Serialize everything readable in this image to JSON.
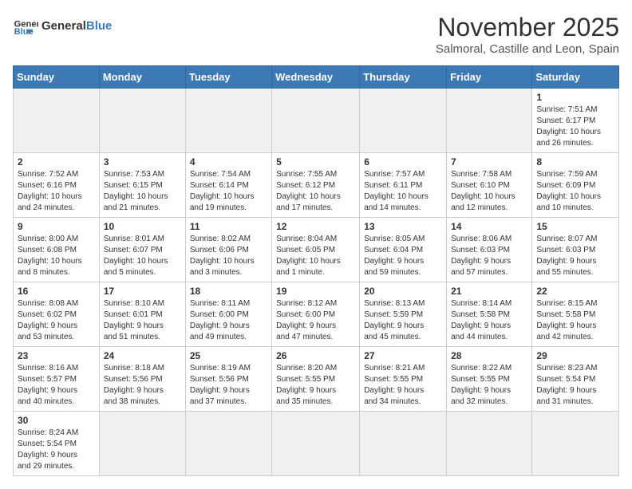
{
  "header": {
    "logo_text_normal": "General",
    "logo_text_accent": "Blue",
    "month_year": "November 2025",
    "location": "Salmoral, Castille and Leon, Spain"
  },
  "days_of_week": [
    "Sunday",
    "Monday",
    "Tuesday",
    "Wednesday",
    "Thursday",
    "Friday",
    "Saturday"
  ],
  "weeks": [
    [
      {
        "day": "",
        "info": ""
      },
      {
        "day": "",
        "info": ""
      },
      {
        "day": "",
        "info": ""
      },
      {
        "day": "",
        "info": ""
      },
      {
        "day": "",
        "info": ""
      },
      {
        "day": "",
        "info": ""
      },
      {
        "day": "1",
        "info": "Sunrise: 7:51 AM\nSunset: 6:17 PM\nDaylight: 10 hours\nand 26 minutes."
      }
    ],
    [
      {
        "day": "2",
        "info": "Sunrise: 7:52 AM\nSunset: 6:16 PM\nDaylight: 10 hours\nand 24 minutes."
      },
      {
        "day": "3",
        "info": "Sunrise: 7:53 AM\nSunset: 6:15 PM\nDaylight: 10 hours\nand 21 minutes."
      },
      {
        "day": "4",
        "info": "Sunrise: 7:54 AM\nSunset: 6:14 PM\nDaylight: 10 hours\nand 19 minutes."
      },
      {
        "day": "5",
        "info": "Sunrise: 7:55 AM\nSunset: 6:12 PM\nDaylight: 10 hours\nand 17 minutes."
      },
      {
        "day": "6",
        "info": "Sunrise: 7:57 AM\nSunset: 6:11 PM\nDaylight: 10 hours\nand 14 minutes."
      },
      {
        "day": "7",
        "info": "Sunrise: 7:58 AM\nSunset: 6:10 PM\nDaylight: 10 hours\nand 12 minutes."
      },
      {
        "day": "8",
        "info": "Sunrise: 7:59 AM\nSunset: 6:09 PM\nDaylight: 10 hours\nand 10 minutes."
      }
    ],
    [
      {
        "day": "9",
        "info": "Sunrise: 8:00 AM\nSunset: 6:08 PM\nDaylight: 10 hours\nand 8 minutes."
      },
      {
        "day": "10",
        "info": "Sunrise: 8:01 AM\nSunset: 6:07 PM\nDaylight: 10 hours\nand 5 minutes."
      },
      {
        "day": "11",
        "info": "Sunrise: 8:02 AM\nSunset: 6:06 PM\nDaylight: 10 hours\nand 3 minutes."
      },
      {
        "day": "12",
        "info": "Sunrise: 8:04 AM\nSunset: 6:05 PM\nDaylight: 10 hours\nand 1 minute."
      },
      {
        "day": "13",
        "info": "Sunrise: 8:05 AM\nSunset: 6:04 PM\nDaylight: 9 hours\nand 59 minutes."
      },
      {
        "day": "14",
        "info": "Sunrise: 8:06 AM\nSunset: 6:03 PM\nDaylight: 9 hours\nand 57 minutes."
      },
      {
        "day": "15",
        "info": "Sunrise: 8:07 AM\nSunset: 6:03 PM\nDaylight: 9 hours\nand 55 minutes."
      }
    ],
    [
      {
        "day": "16",
        "info": "Sunrise: 8:08 AM\nSunset: 6:02 PM\nDaylight: 9 hours\nand 53 minutes."
      },
      {
        "day": "17",
        "info": "Sunrise: 8:10 AM\nSunset: 6:01 PM\nDaylight: 9 hours\nand 51 minutes."
      },
      {
        "day": "18",
        "info": "Sunrise: 8:11 AM\nSunset: 6:00 PM\nDaylight: 9 hours\nand 49 minutes."
      },
      {
        "day": "19",
        "info": "Sunrise: 8:12 AM\nSunset: 6:00 PM\nDaylight: 9 hours\nand 47 minutes."
      },
      {
        "day": "20",
        "info": "Sunrise: 8:13 AM\nSunset: 5:59 PM\nDaylight: 9 hours\nand 45 minutes."
      },
      {
        "day": "21",
        "info": "Sunrise: 8:14 AM\nSunset: 5:58 PM\nDaylight: 9 hours\nand 44 minutes."
      },
      {
        "day": "22",
        "info": "Sunrise: 8:15 AM\nSunset: 5:58 PM\nDaylight: 9 hours\nand 42 minutes."
      }
    ],
    [
      {
        "day": "23",
        "info": "Sunrise: 8:16 AM\nSunset: 5:57 PM\nDaylight: 9 hours\nand 40 minutes."
      },
      {
        "day": "24",
        "info": "Sunrise: 8:18 AM\nSunset: 5:56 PM\nDaylight: 9 hours\nand 38 minutes."
      },
      {
        "day": "25",
        "info": "Sunrise: 8:19 AM\nSunset: 5:56 PM\nDaylight: 9 hours\nand 37 minutes."
      },
      {
        "day": "26",
        "info": "Sunrise: 8:20 AM\nSunset: 5:55 PM\nDaylight: 9 hours\nand 35 minutes."
      },
      {
        "day": "27",
        "info": "Sunrise: 8:21 AM\nSunset: 5:55 PM\nDaylight: 9 hours\nand 34 minutes."
      },
      {
        "day": "28",
        "info": "Sunrise: 8:22 AM\nSunset: 5:55 PM\nDaylight: 9 hours\nand 32 minutes."
      },
      {
        "day": "29",
        "info": "Sunrise: 8:23 AM\nSunset: 5:54 PM\nDaylight: 9 hours\nand 31 minutes."
      }
    ],
    [
      {
        "day": "30",
        "info": "Sunrise: 8:24 AM\nSunset: 5:54 PM\nDaylight: 9 hours\nand 29 minutes."
      },
      {
        "day": "",
        "info": ""
      },
      {
        "day": "",
        "info": ""
      },
      {
        "day": "",
        "info": ""
      },
      {
        "day": "",
        "info": ""
      },
      {
        "day": "",
        "info": ""
      },
      {
        "day": "",
        "info": ""
      }
    ]
  ]
}
